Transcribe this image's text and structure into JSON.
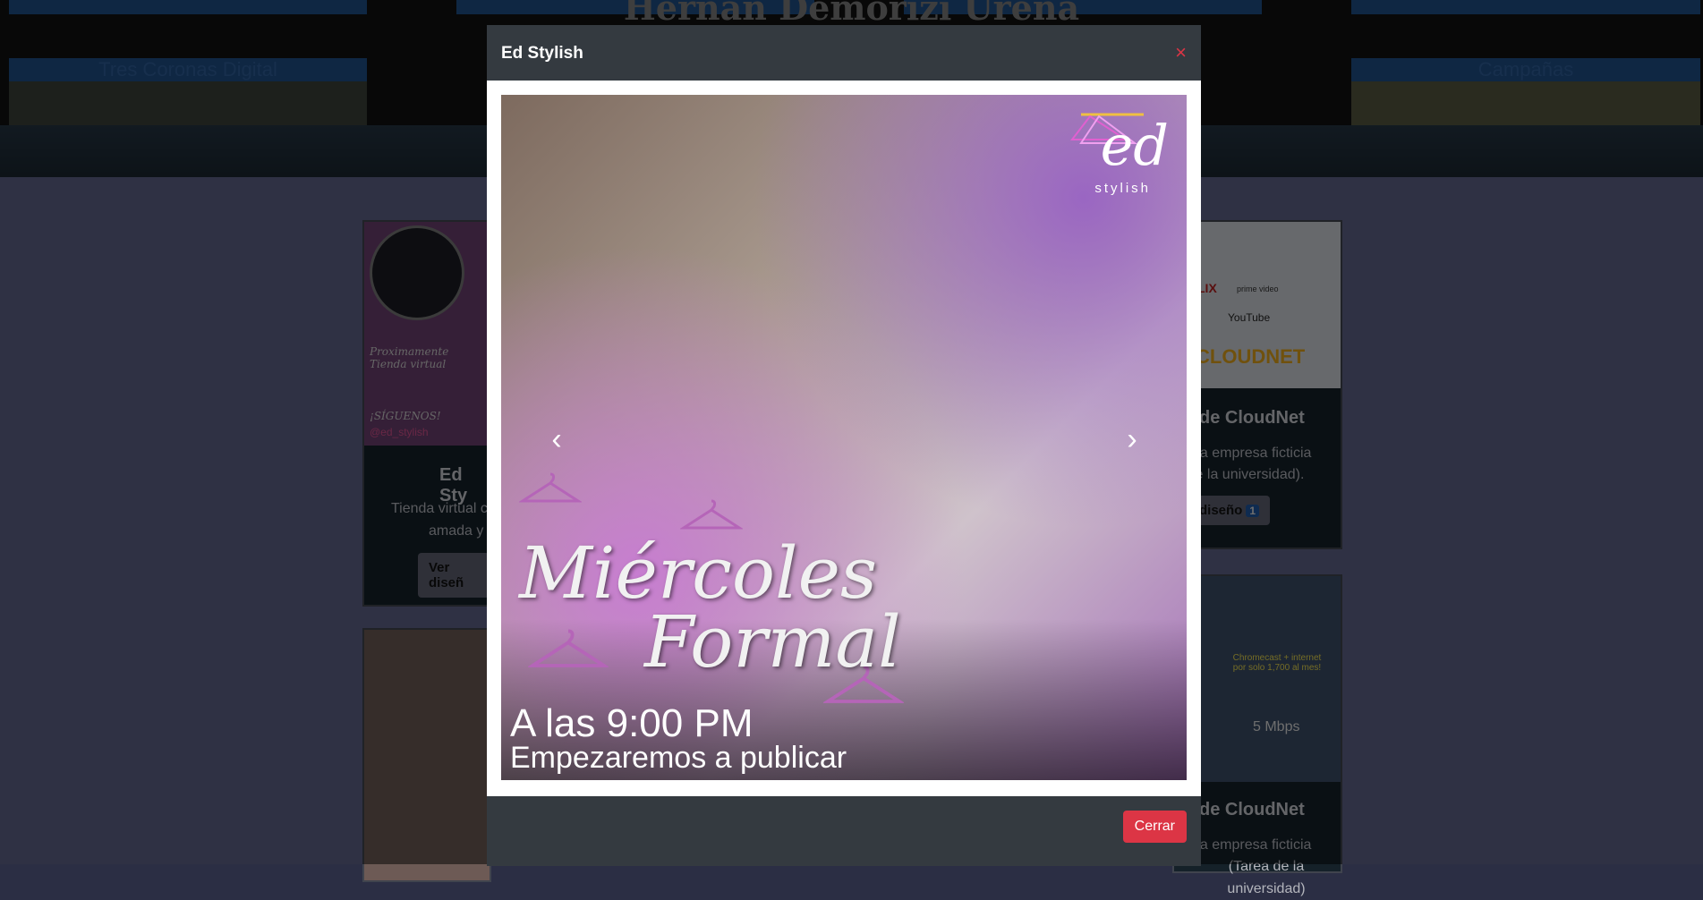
{
  "background_page": {
    "name_title": "Hernan Demorizi Ureña",
    "top_tabs": [
      "",
      "",
      "",
      ""
    ],
    "thumb_tabs": [
      "Tres Coronas Digital",
      "Campañas"
    ],
    "cards": [
      {
        "logo_caption": "Proximamente Tienda virtual",
        "follow_text": "¡SÍGUENOS!",
        "instagram": "@ed_stylish",
        "title": "Ed Sty",
        "text": [
          "Tienda virtual c",
          "amada y"
        ],
        "button": "Ver diseñ"
      },
      {
        "logo_title": "CLOUDNET",
        "logo_extra": [
          "LIX",
          "prime video",
          "YouTube"
        ],
        "title": "de CloudNet",
        "text": [
          "na empresa ficticia",
          "le la universidad)."
        ],
        "button": "r diseño",
        "badge": "1"
      },
      {
        "title": "de CloudNet",
        "text": [
          "na empresa ficticia",
          "(Tarea de la universidad)"
        ],
        "promo_text": [
          "Chromecast + internet por solo 1,700 al mes!",
          "5 Mbps"
        ]
      }
    ]
  },
  "modal": {
    "title": "Ed Stylish",
    "close_symbol": "×",
    "slide": {
      "brand_script": "ed",
      "brand_sub": "stylish",
      "headline_line1": "Miércoles",
      "headline_line2": "Formal",
      "time_text": "A las 9:00 PM",
      "sub_text": "Empezaremos a publicar"
    },
    "prev_symbol": "‹",
    "next_symbol": "›",
    "footer_button": "Cerrar"
  },
  "colors": {
    "modal_bg": "#343a40",
    "danger": "#dc3545",
    "page_bg": "#5f6388"
  }
}
